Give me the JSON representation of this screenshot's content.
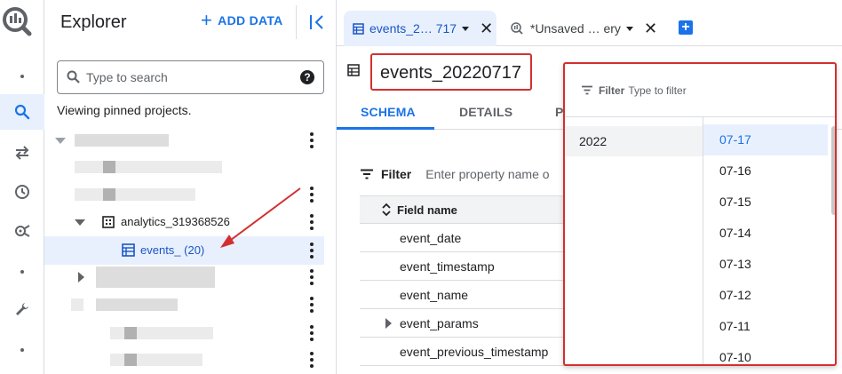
{
  "colors": {
    "accent": "#1a73e8",
    "highlight_border": "#d32f2f",
    "selected_bg": "#e8f0fe"
  },
  "rail": {
    "icons": [
      "bigquery-logo-icon",
      "dot-icon",
      "search-icon",
      "transfer-icon",
      "history-icon",
      "analytics-icon",
      "dot-icon",
      "wrench-icon",
      "dot-icon"
    ]
  },
  "explorer": {
    "title": "Explorer",
    "add_data": "ADD DATA",
    "search_placeholder": "Type to search",
    "pinned_note": "Viewing pinned projects.",
    "dataset_label": "analytics_319368526",
    "table_label": "events_ (20)"
  },
  "tabs": [
    {
      "label": "events_2… 717",
      "active": true
    },
    {
      "label": "*Unsaved … ery",
      "active": false
    }
  ],
  "table_title": "events_20220717",
  "subtabs": [
    "SCHEMA",
    "DETAILS",
    "P"
  ],
  "schema": {
    "filter_label": "Filter",
    "filter_placeholder": "Enter property name o",
    "column_header": "Field name",
    "fields": [
      "event_date",
      "event_timestamp",
      "event_name",
      "event_params",
      "event_previous_timestamp"
    ]
  },
  "date_dropdown": {
    "filter_label": "Filter",
    "filter_placeholder": "Type to filter",
    "year": "2022",
    "days": [
      "07-17",
      "07-16",
      "07-15",
      "07-14",
      "07-13",
      "07-12",
      "07-11",
      "07-10"
    ],
    "selected_day": "07-17"
  }
}
